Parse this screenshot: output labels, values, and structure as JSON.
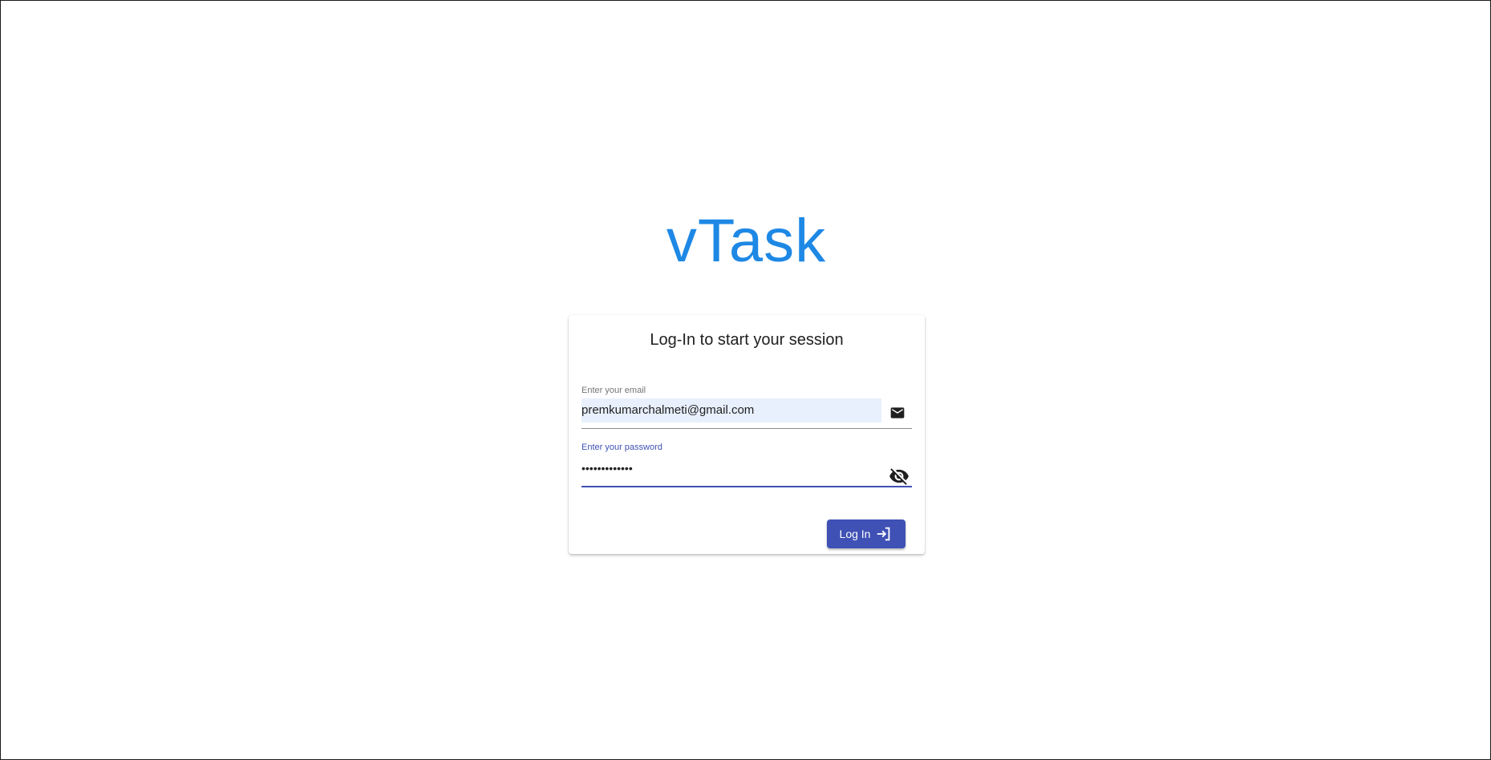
{
  "app": {
    "title": "vTask",
    "brand_color": "#1e88e5"
  },
  "login_card": {
    "heading": "Log-In to start your session",
    "email": {
      "label": "Enter your email",
      "value": "premkumarchalmeti@gmail.com",
      "icon": "mail-icon",
      "autofill_color": "#e8f0fe"
    },
    "password": {
      "label": "Enter your password",
      "value": "•••••••••••••",
      "icon": "eye-off-icon",
      "focused": true,
      "focus_color": "#3f51b5"
    },
    "submit": {
      "label": "Log In",
      "icon": "login-icon",
      "color": "#3f51b5"
    }
  }
}
